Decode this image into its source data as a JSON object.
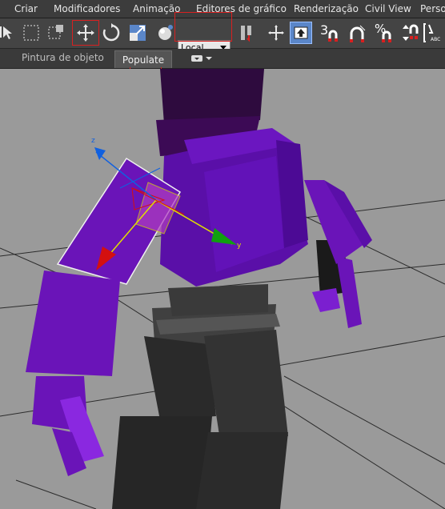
{
  "menu": {
    "items": [
      "Criar",
      "Modificadores",
      "Animação",
      "Editores de gráfico",
      "Renderização",
      "Civil View",
      "Perso"
    ]
  },
  "toolbar": {
    "reference_coordinate_system": "Local",
    "snaps_label": "3",
    "percent_snap_label": "%",
    "abc_label": "ABC",
    "icons": [
      "select-pointer-icon",
      "rect-select-icon",
      "window-crossing-icon",
      "select-move-icon",
      "select-rotate-icon",
      "select-scale-icon",
      "use-pivot-icon",
      "reference-dropdown",
      "mirror-icon",
      "select-manipulate-icon",
      "keyboard-shortcut-icon",
      "snap-toggle-icon",
      "angle-snap-icon",
      "percent-snap-icon",
      "spinner-snap-icon",
      "edit-named-selection-icon"
    ]
  },
  "ribbon": {
    "tabs": [
      "Pintura de objeto",
      "Populate"
    ],
    "active_tab": "Populate"
  },
  "viewport": {
    "gizmo_axes": [
      "z",
      "y"
    ],
    "colors": {
      "background": "#9a9a9a",
      "model_purple": "#6a14b8",
      "model_dark": "#2e2e2e",
      "axis_x": "#d41010",
      "axis_y": "#10a010",
      "axis_z": "#1060e0",
      "highlight": "#d82020"
    }
  }
}
